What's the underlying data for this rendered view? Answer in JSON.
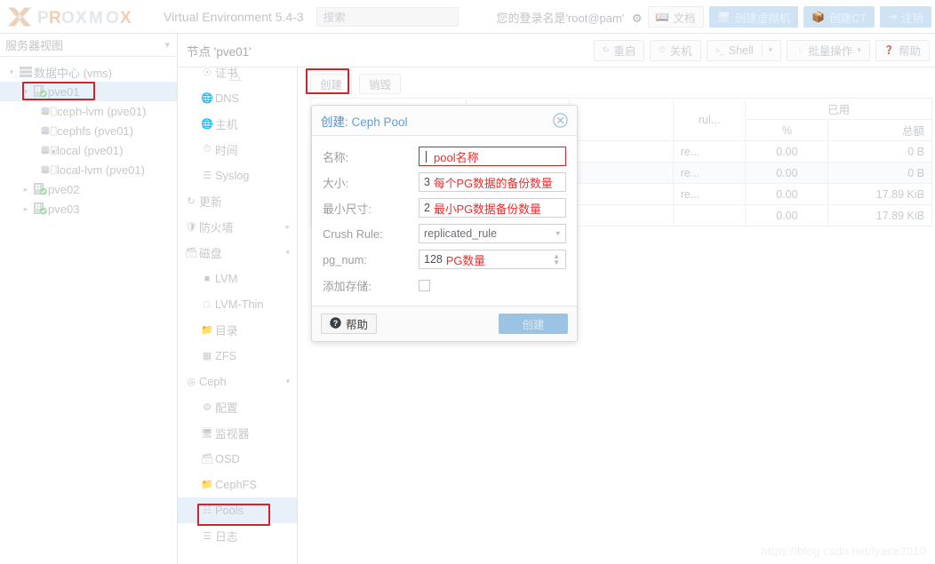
{
  "topbar": {
    "brand": "PROXMOX",
    "product": "Virtual Environment 5.4-3",
    "search_placeholder": "搜索",
    "login_text": "您的登录名是'root@pam'",
    "gear_icon": "gear-icon",
    "buttons": [
      {
        "label": "文档",
        "icon": "book-icon",
        "style": "plain"
      },
      {
        "label": "创建虚拟机",
        "icon": "monitor-icon",
        "style": "blue"
      },
      {
        "label": "创建CT",
        "icon": "box-icon",
        "style": "blue"
      },
      {
        "label": "注销",
        "icon": "logout-icon",
        "style": "blue"
      }
    ]
  },
  "sidebar": {
    "header": "服务器视图",
    "chevron_icon": "chevron-down-icon",
    "tree": [
      {
        "label": "数据中心 (vms)",
        "level": 0,
        "icon": "datacenter-icon",
        "arrow": "caret-down",
        "selected": false
      },
      {
        "label": "pve01",
        "level": 1,
        "icon": "node-ok-icon",
        "arrow": "caret-down",
        "selected": true,
        "highlight": true
      },
      {
        "label": "ceph-lvm (pve01)",
        "level": 2,
        "icon": "storage-icon",
        "arrow": "",
        "selected": false
      },
      {
        "label": "cephfs (pve01)",
        "level": 2,
        "icon": "storage-icon",
        "arrow": "",
        "selected": false
      },
      {
        "label": "local (pve01)",
        "level": 2,
        "icon": "storage-local-icon",
        "arrow": "",
        "selected": false
      },
      {
        "label": "local-lvm (pve01)",
        "level": 2,
        "icon": "storage-icon",
        "arrow": "",
        "selected": false
      },
      {
        "label": "pve02",
        "level": 1,
        "icon": "node-ok-icon",
        "arrow": "caret-right",
        "selected": false
      },
      {
        "label": "pve03",
        "level": 1,
        "icon": "node-ok-icon",
        "arrow": "caret-right",
        "selected": false
      }
    ]
  },
  "content_header": {
    "title": "节点 'pve01'",
    "buttons": [
      {
        "label": "重启",
        "icon": "restart-icon",
        "split": false
      },
      {
        "label": "关机",
        "icon": "power-icon",
        "split": false
      },
      {
        "label": "Shell",
        "icon": "terminal-icon",
        "split": true
      },
      {
        "label": "批量操作",
        "icon": "dots-vertical-icon",
        "split": true
      },
      {
        "label": "帮助",
        "icon": "help-icon",
        "split": false
      }
    ]
  },
  "node_menu": {
    "scroll_up_icon": "scroll-up-arrow-icon",
    "items": [
      {
        "label": "证书",
        "icon": "certificate-icon",
        "indent": 1,
        "selected": false,
        "expand": "",
        "clipped": true
      },
      {
        "label": "DNS",
        "icon": "globe-icon",
        "indent": 1,
        "selected": false,
        "expand": ""
      },
      {
        "label": "主机",
        "icon": "globe-icon",
        "indent": 1,
        "selected": false,
        "expand": ""
      },
      {
        "label": "时间",
        "icon": "clock-icon",
        "indent": 1,
        "selected": false,
        "expand": ""
      },
      {
        "label": "Syslog",
        "icon": "list-icon",
        "indent": 1,
        "selected": false,
        "expand": ""
      },
      {
        "label": "更新",
        "icon": "refresh-icon",
        "indent": 0,
        "selected": false,
        "expand": ""
      },
      {
        "label": "防火墙",
        "icon": "shield-icon",
        "indent": 0,
        "selected": false,
        "expand": "caret-right"
      },
      {
        "label": "磁盘",
        "icon": "disk-icon",
        "indent": 0,
        "selected": false,
        "expand": "caret-down"
      },
      {
        "label": "LVM",
        "icon": "square-filled-icon",
        "indent": 1,
        "selected": false,
        "expand": ""
      },
      {
        "label": "LVM-Thin",
        "icon": "square-outline-icon",
        "indent": 1,
        "selected": false,
        "expand": ""
      },
      {
        "label": "目录",
        "icon": "folder-icon",
        "indent": 1,
        "selected": false,
        "expand": ""
      },
      {
        "label": "ZFS",
        "icon": "grid-icon",
        "indent": 1,
        "selected": false,
        "expand": ""
      },
      {
        "label": "Ceph",
        "icon": "ceph-icon",
        "indent": 0,
        "selected": false,
        "expand": "caret-down"
      },
      {
        "label": "配置",
        "icon": "gear-icon",
        "indent": 1,
        "selected": false,
        "expand": ""
      },
      {
        "label": "监视器",
        "icon": "monitor-icon",
        "indent": 1,
        "selected": false,
        "expand": ""
      },
      {
        "label": "OSD",
        "icon": "disk-icon",
        "indent": 1,
        "selected": false,
        "expand": ""
      },
      {
        "label": "CephFS",
        "icon": "folder-icon",
        "indent": 1,
        "selected": false,
        "expand": ""
      },
      {
        "label": "Pools",
        "icon": "pools-icon",
        "indent": 1,
        "selected": true,
        "expand": "",
        "highlight": true
      },
      {
        "label": "日志",
        "icon": "list-icon",
        "indent": 1,
        "selected": false,
        "expand": ""
      }
    ]
  },
  "pools_panel": {
    "toolbar": {
      "create_label": "创建",
      "create_highlight": true,
      "destroy_label": "销毁"
    },
    "table": {
      "group_header": "已用",
      "columns": [
        "rul...",
        "%",
        "总额"
      ],
      "rows": [
        {
          "rule": "re...",
          "percent": "0.00",
          "total": "0 B"
        },
        {
          "rule": "re...",
          "percent": "0.00",
          "total": "0 B"
        },
        {
          "rule": "re...",
          "percent": "0.00",
          "total": "17.89 KiB"
        },
        {
          "rule": "",
          "percent": "0.00",
          "total": "17.89 KiB"
        }
      ]
    }
  },
  "dialog": {
    "title_prefix": "创建",
    "title_sep": ": ",
    "title_main": "Ceph Pool",
    "close_icon": "close-circle-icon",
    "fields": [
      {
        "label": "名称:",
        "value": "",
        "annotation": "pool名称",
        "type": "text",
        "red_border": true,
        "show_caret": true
      },
      {
        "label": "大小:",
        "value": "3",
        "annotation": "每个PG数据的备份数量",
        "type": "number"
      },
      {
        "label": "最小尺寸:",
        "value": "2",
        "annotation": "最小PG数据备份数量",
        "type": "number"
      },
      {
        "label": "Crush Rule:",
        "value": "replicated_rule",
        "annotation": "",
        "type": "select"
      },
      {
        "label": "pg_num:",
        "value": "128",
        "annotation": "PG数量",
        "type": "spinner"
      },
      {
        "label": "添加存储:",
        "value": "",
        "annotation": "",
        "type": "checkbox",
        "checked": false
      }
    ],
    "footer": {
      "help_label": "帮助",
      "help_icon": "help-icon",
      "submit_label": "创建"
    }
  },
  "watermark": "https://blog.csdn.net/lyace2010",
  "colors": {
    "accent_blue": "#4a93d4",
    "annotation_red": "#ef2c2c",
    "highlight_border": "#d3232a",
    "selection_bg": "#e8f1fa",
    "button_blue": "#9bc4e4",
    "brand_orange": "#e8a87c"
  }
}
